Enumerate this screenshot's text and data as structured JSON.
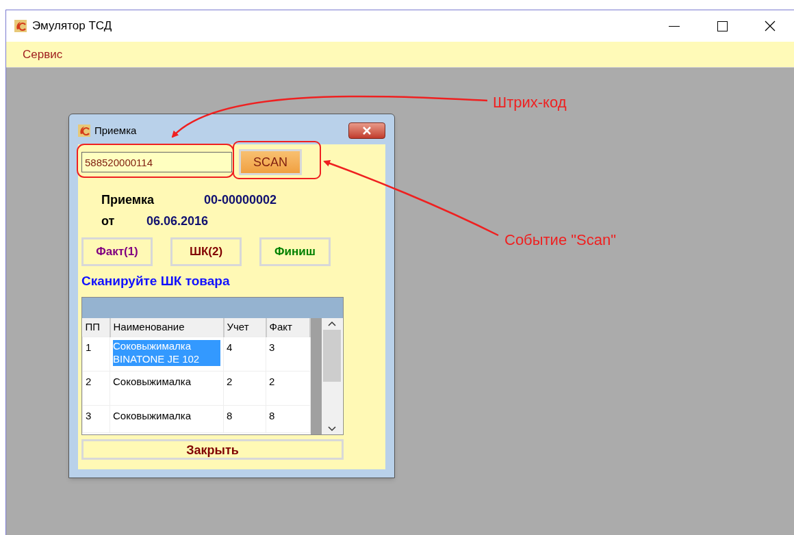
{
  "window": {
    "title": "Эмулятор ТСД"
  },
  "menu": [
    "Сервис"
  ],
  "dialog": {
    "title": "Приемка",
    "barcode": {
      "value": "588520000114"
    },
    "scan_button": "SCAN",
    "doc_label": "Приемка",
    "doc_number": "00-00000002",
    "date_label": "от",
    "date": "06.06.2016",
    "buttons": [
      {
        "label": "Факт(1)",
        "color": "#800080"
      },
      {
        "label": "ШК(2)",
        "color": "#800000"
      },
      {
        "label": "Финиш",
        "color": "#008000"
      }
    ],
    "instruction": "Сканируйте ШК товара",
    "table": {
      "columns": [
        "ПП",
        "Наименование",
        "Учет",
        "Факт"
      ],
      "rows": [
        {
          "cells": [
            "1",
            "Соковыжималка BINATONE JE 102",
            "4",
            "3"
          ],
          "selected": true
        },
        {
          "cells": [
            "2",
            "Соковыжималка",
            "2",
            "2"
          ],
          "selected": false
        },
        {
          "cells": [
            "3",
            "Соковыжималка",
            "8",
            "8"
          ],
          "selected": false
        }
      ]
    },
    "close_button": "Закрыть"
  },
  "annotations": [
    "Штрих-код",
    "Событие \"Scan\""
  ]
}
